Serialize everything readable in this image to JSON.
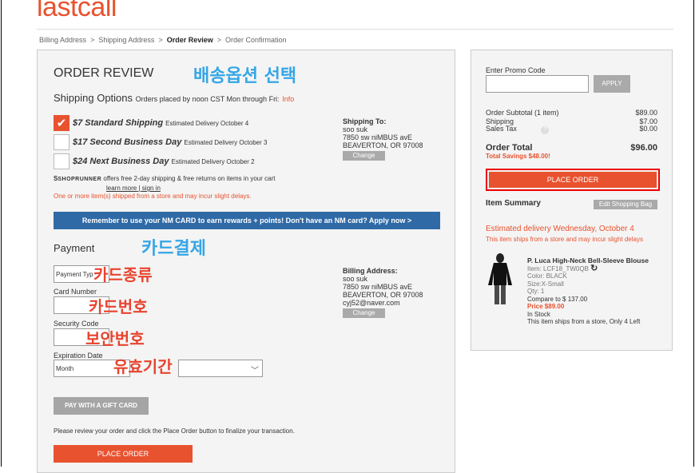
{
  "brand": {
    "logo": "lastcall"
  },
  "breadcrumb": {
    "step1": "Billing Address",
    "step2": "Shipping Address",
    "step3": "Order Review",
    "step4": "Order Confirmation",
    "sep": ">"
  },
  "review": {
    "title": "ORDER REVIEW",
    "annotation_shipping": "배송옵션 선택",
    "shipping_heading": "Shipping Options",
    "shipping_note": "Orders placed by noon CST Mon through Fri:",
    "info_link": "Info",
    "options": [
      {
        "label": "$7 Standard Shipping",
        "est": "Estimated Delivery October 4",
        "checked": true
      },
      {
        "label": "$17 Second Business Day",
        "est": "Estimated Delivery October 3",
        "checked": false
      },
      {
        "label": "$24 Next Business Day",
        "est": "Estimated Delivery October 2",
        "checked": false
      }
    ],
    "shoprunner_brand": "SHOPRUNNER",
    "shoprunner_text": "offers free 2-day shipping & free returns on items in your cart",
    "learn_more": "learn more",
    "pipe": "|",
    "sign_in": "sign in",
    "warning": "One or more item(s) shipped from a store and may incur slight delays.",
    "shipping_to": {
      "heading": "Shipping To:",
      "name": "soo suk",
      "street": "7850 sw niMBUS avE",
      "city": "BEAVERTON, OR 97008",
      "change": "Change"
    },
    "banner": "Remember to use your NM CARD to earn rewards + points! Don't have an NM card? Apply now >"
  },
  "payment": {
    "heading": "Payment",
    "annotation_payment": "카드결제",
    "payment_type_value": "Payment Typ",
    "annotation_card_type": "카드종류",
    "card_number_label": "Card Number",
    "annotation_card_number": "카드번호",
    "security_label": "Security Code",
    "annotation_security": "보안번호",
    "expiration_label": "Expiration Date",
    "month_value": "Month",
    "annotation_expiration": "유효기간",
    "billing": {
      "heading": "Billing Address:",
      "name": "soo suk",
      "street": "7850 sw niMBUS avE",
      "city": "BEAVERTON, OR 97008",
      "email": "cyj52@naver.com",
      "change": "Change"
    },
    "gift_button": "PAY WITH A GIFT CARD",
    "note": "Please review your order and click the Place Order button to finalize your transaction.",
    "place_order": "PLACE ORDER"
  },
  "summary": {
    "promo_label": "Enter Promo Code",
    "apply": "APPLY",
    "subtotal_label": "Order Subtotal (1 item)",
    "subtotal": "$89.00",
    "shipping_label": "Shipping",
    "shipping": "$7.00",
    "tax_label": "Sales Tax",
    "tax_help": "?",
    "tax": "$0.00",
    "total_label": "Order Total",
    "total": "$96.00",
    "savings": "Total Savings $48.00!",
    "place_order": "PLACE ORDER",
    "item_summary": "Item Summary",
    "edit_bag": "Edit Shopping Bag",
    "est_delivery": "Estimated delivery Wednesday, October 4",
    "est_note": "This item ships from a store and may incur slight delays",
    "product": {
      "name": "P. Luca High-Neck Bell-Sleeve Blouse",
      "item": "Item: LCF18_TW0QB",
      "color": "Color: BLACK",
      "size": "Size:X-Small",
      "qty": "Qty: 1",
      "compare": "Compare to $ 137.00",
      "price": "Price $89.00",
      "stock": "In Stock",
      "ships": "This item ships from a store, Only 4 Left"
    }
  },
  "colors": {
    "accent": "#e8522e",
    "banner": "#2f6aa6",
    "annotation_blue": "#35a6e6",
    "annotation_red": "#e8432e"
  }
}
